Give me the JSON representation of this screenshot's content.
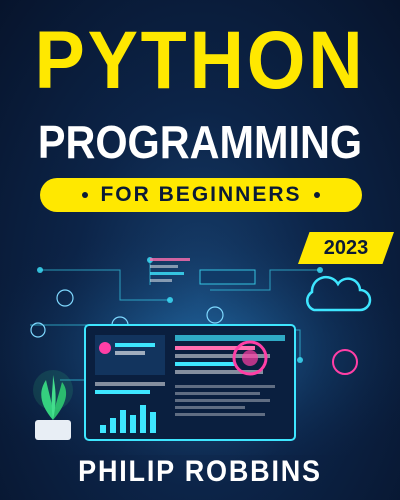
{
  "cover": {
    "title_main": "PYTHON",
    "title_sub": "PROGRAMMING",
    "subtitle": "FOR BEGINNERS",
    "year": "2023",
    "author": "PHILIP ROBBINS"
  },
  "colors": {
    "accent": "#ffe800",
    "background": "#0c2448",
    "neon_cyan": "#3ee6ff",
    "neon_pink": "#ff3fa6"
  }
}
